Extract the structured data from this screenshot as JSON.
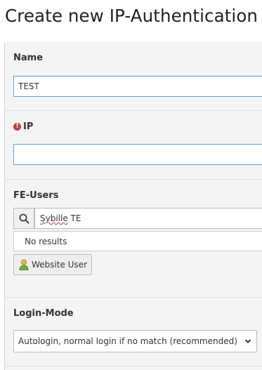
{
  "page": {
    "title": "Create new IP-Authentication conf"
  },
  "fields": {
    "name": {
      "label": "Name",
      "value": "TEST"
    },
    "ip": {
      "label": "IP",
      "value": "",
      "error_icon": "exclamation-circle-icon"
    },
    "fe_users": {
      "label": "FE-Users",
      "search_value_prefix": "Sybille",
      "search_value_suffix": " TE",
      "search_icon": "search-icon",
      "results_text": "No results",
      "record_button_label": "Website User",
      "record_icon": "website-user-icon"
    },
    "login_mode": {
      "label": "Login-Mode",
      "selected_option": "Autologin, normal login if no match (recommended)",
      "chevron_icon": "chevron-down-icon"
    }
  },
  "colors": {
    "focus_border": "#5d9ed8",
    "error": "#c83c3c",
    "section_background": "#f4f4f4"
  }
}
